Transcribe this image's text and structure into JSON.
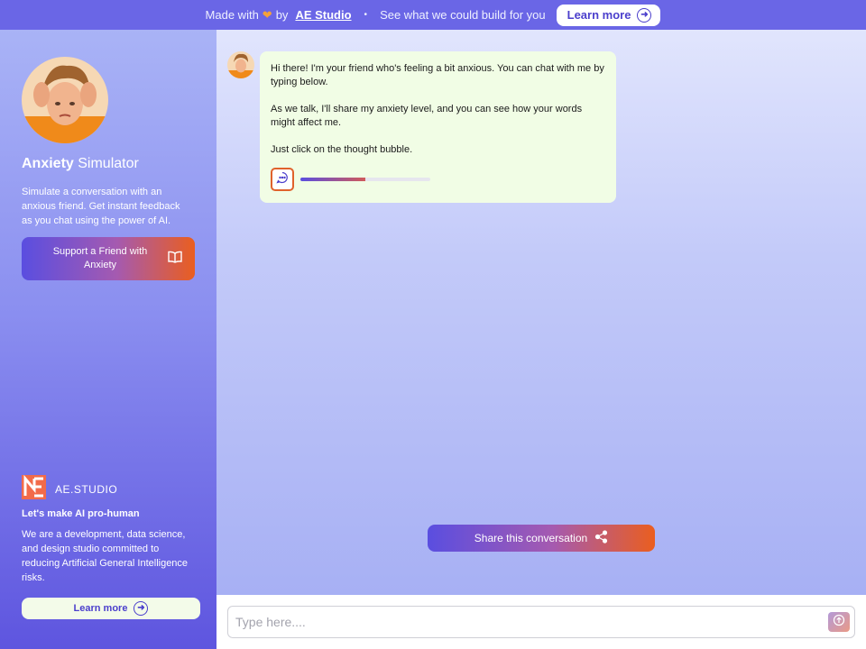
{
  "banner": {
    "made_with": "Made with",
    "heart": "❤",
    "by": "by",
    "brand": "AE Studio",
    "separator": "•",
    "pitch": "See what we could build for you",
    "learn_more": "Learn more"
  },
  "sidebar": {
    "title_bold": "Anxiety",
    "title_rest": "Simulator",
    "description": "Simulate a conversation with an anxious friend. Get instant feedback as you chat using the power of AI.",
    "support_button": "Support a Friend with Anxiety",
    "company_logo_text": "AE.STUDIO",
    "tagline": "Let's make AI pro-human",
    "company_description": "We are a development, data science, and design studio committed to reducing Artificial General Intelligence risks.",
    "learn_more": "Learn more"
  },
  "chat": {
    "messages": [
      {
        "sender": "friend",
        "paragraphs": [
          "Hi there! I'm your friend who's feeling a bit anxious. You can chat with me by typing below.",
          "As we talk, I'll share my anxiety level, and you can see how your words might affect me.",
          "Just click on the thought bubble."
        ],
        "anxiety_level": 0.5
      }
    ],
    "share_button": "Share this conversation"
  },
  "input": {
    "placeholder": "Type here...."
  },
  "colors": {
    "accent_purple": "#5a4ee0",
    "accent_orange": "#ea5e1f",
    "bubble_bg": "#f1fde5"
  }
}
